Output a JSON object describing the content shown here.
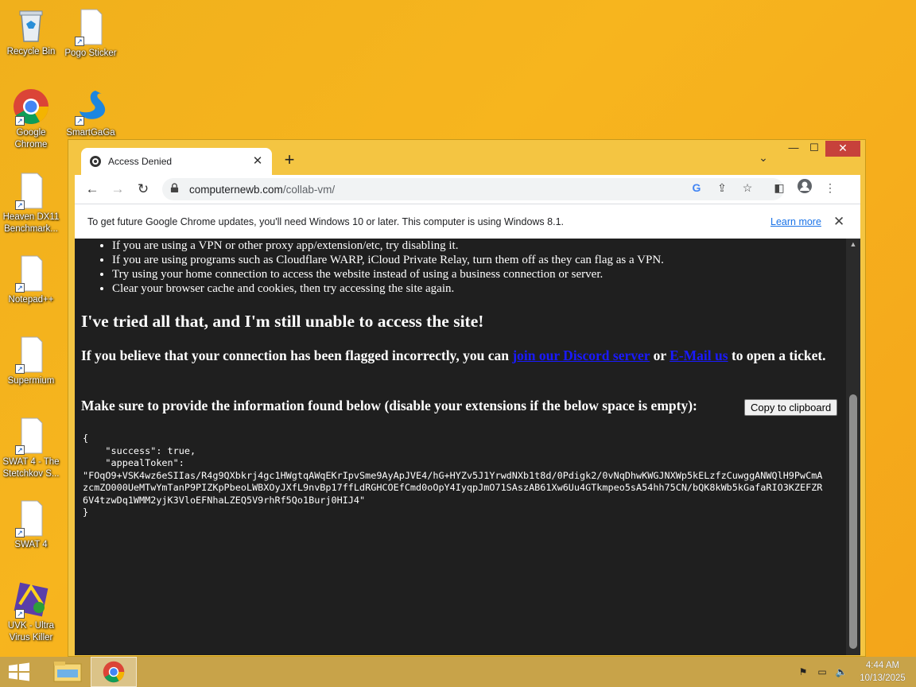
{
  "desktop": {
    "icons": [
      {
        "label": "Recycle Bin"
      },
      {
        "label": "Pogo Sticker"
      },
      {
        "label": "Google Chrome"
      },
      {
        "label": "SmartGaGa"
      },
      {
        "label": "Heaven DX11 Benchmark..."
      },
      {
        "label": "Notepad++"
      },
      {
        "label": "Supermium"
      },
      {
        "label": "SWAT 4 - The Stetchkov S..."
      },
      {
        "label": "SWAT 4"
      },
      {
        "label": "UVK - Ultra Virus Killer"
      }
    ]
  },
  "browser": {
    "tab_title": "Access Denied",
    "url_domain": "computernewb.com",
    "url_path": "/collab-vm/",
    "infobar_text": "To get future Google Chrome updates, you'll need Windows 10 or later. This computer is using Windows 8.1.",
    "infobar_link": "Learn more"
  },
  "page": {
    "tips": [
      "If you are using a VPN or other proxy app/extension/etc, try disabling it.",
      "If you are using programs such as Cloudflare WARP, iCloud Private Relay, turn them off as they can flag as a VPN.",
      "Try using your home connection to access the website instead of using a business connection or server.",
      "Clear your browser cache and cookies, then try accessing the site again."
    ],
    "heading": "I've tried all that, and I'm still unable to access the site!",
    "flagged_before": "If you believe that your connection has been flagged incorrectly, you can ",
    "flagged_link1": "join our Discord server",
    "flagged_middle": " or ",
    "flagged_link2": "E-Mail us",
    "flagged_after": " to open a ticket.",
    "provide_text": "Make sure to provide the information found below (disable your extensions if the below space is empty):",
    "copy_button": "Copy to clipboard",
    "json_text": "{\n    \"success\": true,\n    \"appealToken\":\n\"FOqO9+VSK4wz6eSIIas/R4g9QXbkrj4gc1HWgtqAWqEKrIpvSme9AyApJVE4/hG+HYZv5J1YrwdNXb1t8d/0Pdigk2/0vNqDhwKWGJNXWp5kELzfzCuwggANWQlH9PwCmA\nzcmZO000UeMTwYmTanP9PIZKpPbeoLWBXOyJXfL9nvBp17ffLdRGHCOEfCmd0oOpY4IyqpJmO71SAszAB61Xw6Uu4GTkmpeo5sA54hh75CN/bQK8kWb5kGafaRIO3KZEFZR\n6V4tzwDq1WMM2yjK3VloEFNhaLZEQ5V9rhRf5Qo1Burj0HIJ4\"\n}"
  },
  "taskbar": {
    "time": "4:44 AM",
    "date": "10/13/2025"
  },
  "colors": {
    "desktop_bg": "#f5a623",
    "taskbar_bg": "#c8a349",
    "page_bg": "#1f1f1f",
    "link": "#1a1aff",
    "close_button": "#c7413b"
  }
}
